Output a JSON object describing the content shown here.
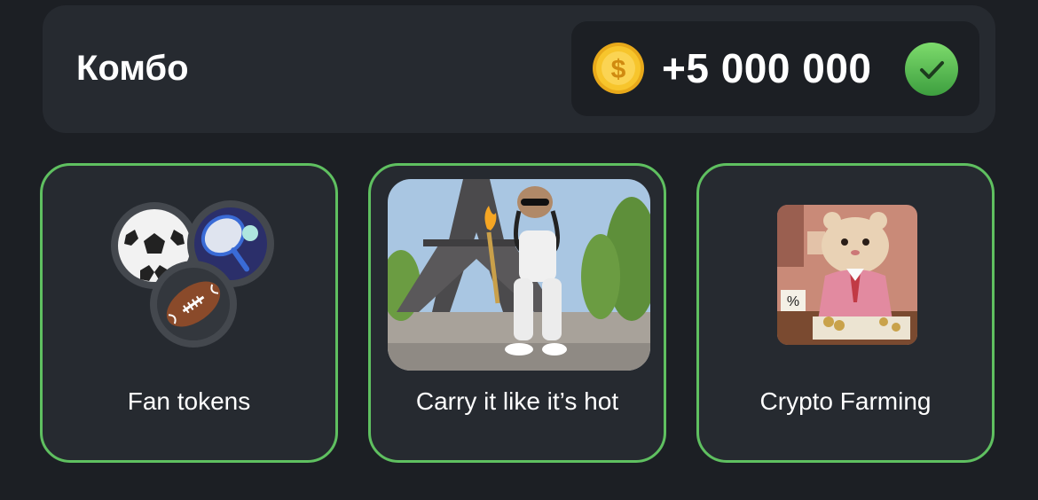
{
  "header": {
    "title": "Комбо",
    "reward_amount": "+5 000 000",
    "coin_icon": "coin-dollar-icon",
    "check_icon": "checkmark-circle-icon"
  },
  "cards": [
    {
      "label": "Fan tokens",
      "image": "sports-balls-icons"
    },
    {
      "label": "Carry it like it’s hot",
      "image": "hamster-torch-eiffel-tower-photo"
    },
    {
      "label": "Crypto Farming",
      "image": "hamster-in-suit-office-photo"
    }
  ],
  "colors": {
    "background": "#1c1f24",
    "panel": "#262a30",
    "accent_green": "#5fc060",
    "coin_gold": "#f5c026"
  }
}
